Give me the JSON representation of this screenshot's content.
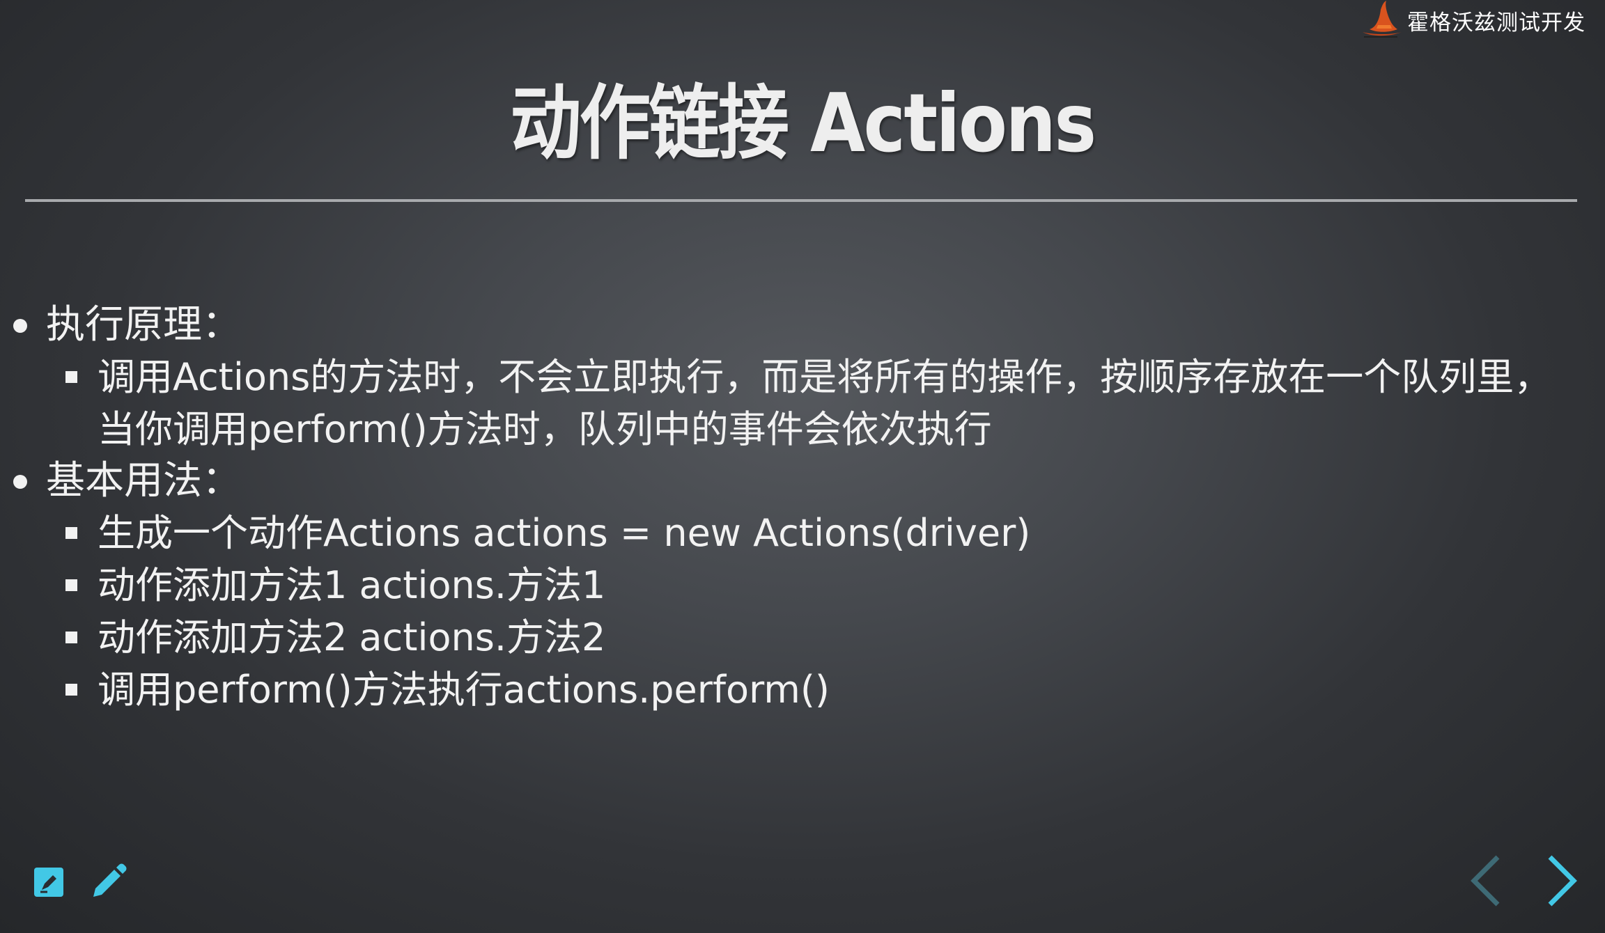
{
  "brand": {
    "name": "霍格沃兹测试开发",
    "logo_icon": "wizard-hat-icon"
  },
  "slide": {
    "title": "动作链接 Actions",
    "sections": [
      {
        "heading": "执行原理：",
        "items": [
          "调用Actions的方法时，不会立即执行，而是将所有的操作，按顺序存放在一个队列里，当你调用perform()方法时，队列中的事件会依次执行"
        ]
      },
      {
        "heading": "基本用法：",
        "items": [
          "生成一个动作Actions actions = new Actions(driver)",
          "动作添加方法1 actions.方法1",
          "动作添加方法2 actions.方法2",
          "调用perform()方法执行actions.perform()"
        ]
      }
    ]
  },
  "controls": {
    "notes_icon": "speaker-notes-icon",
    "pen_icon": "pencil-icon",
    "prev_icon": "chevron-left-icon",
    "next_icon": "chevron-right-icon"
  },
  "colors": {
    "accent": "#42c8e6",
    "nav_disabled": "#3e6a75",
    "text": "#f2f2f2",
    "rule": "#a8aaad"
  }
}
